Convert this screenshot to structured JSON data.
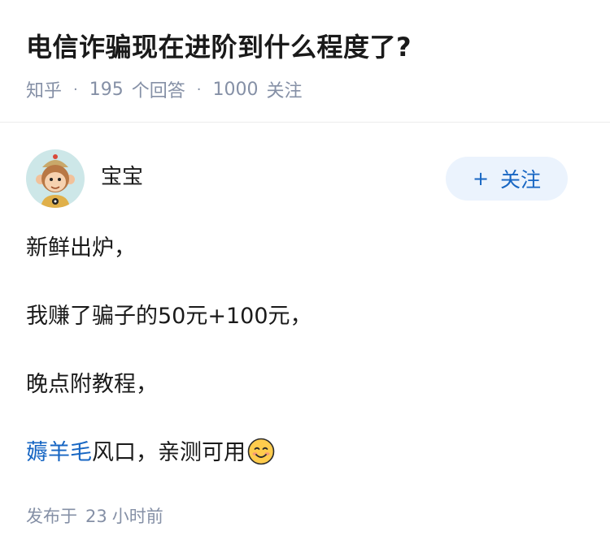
{
  "question": {
    "title": "电信诈骗现在进阶到什么程度了?",
    "source": "知乎",
    "separator": "·",
    "answer_count": "195",
    "answer_count_label": "个回答",
    "follower_count": "1000",
    "follower_label": "关注"
  },
  "author": {
    "name": "宝宝",
    "avatar_icon": "cartoon-monkey-avatar",
    "follow_button_icon": "+",
    "follow_button_label": "关注",
    "follow_button_bg": "#ebf3fd",
    "follow_button_color": "#1766c3"
  },
  "answer": {
    "paragraphs": [
      "新鲜出炉，",
      "我赚了骗子的50元+100元，",
      "晚点附教程，"
    ],
    "last_paragraph": {
      "link_text": "薅羊毛",
      "text": "风口，亲测可用",
      "emoji_icon": "smiling-face-icon"
    },
    "link_color": "#1766c3"
  },
  "publish": {
    "label": "发布于",
    "value": "23",
    "unit": "小时前"
  }
}
